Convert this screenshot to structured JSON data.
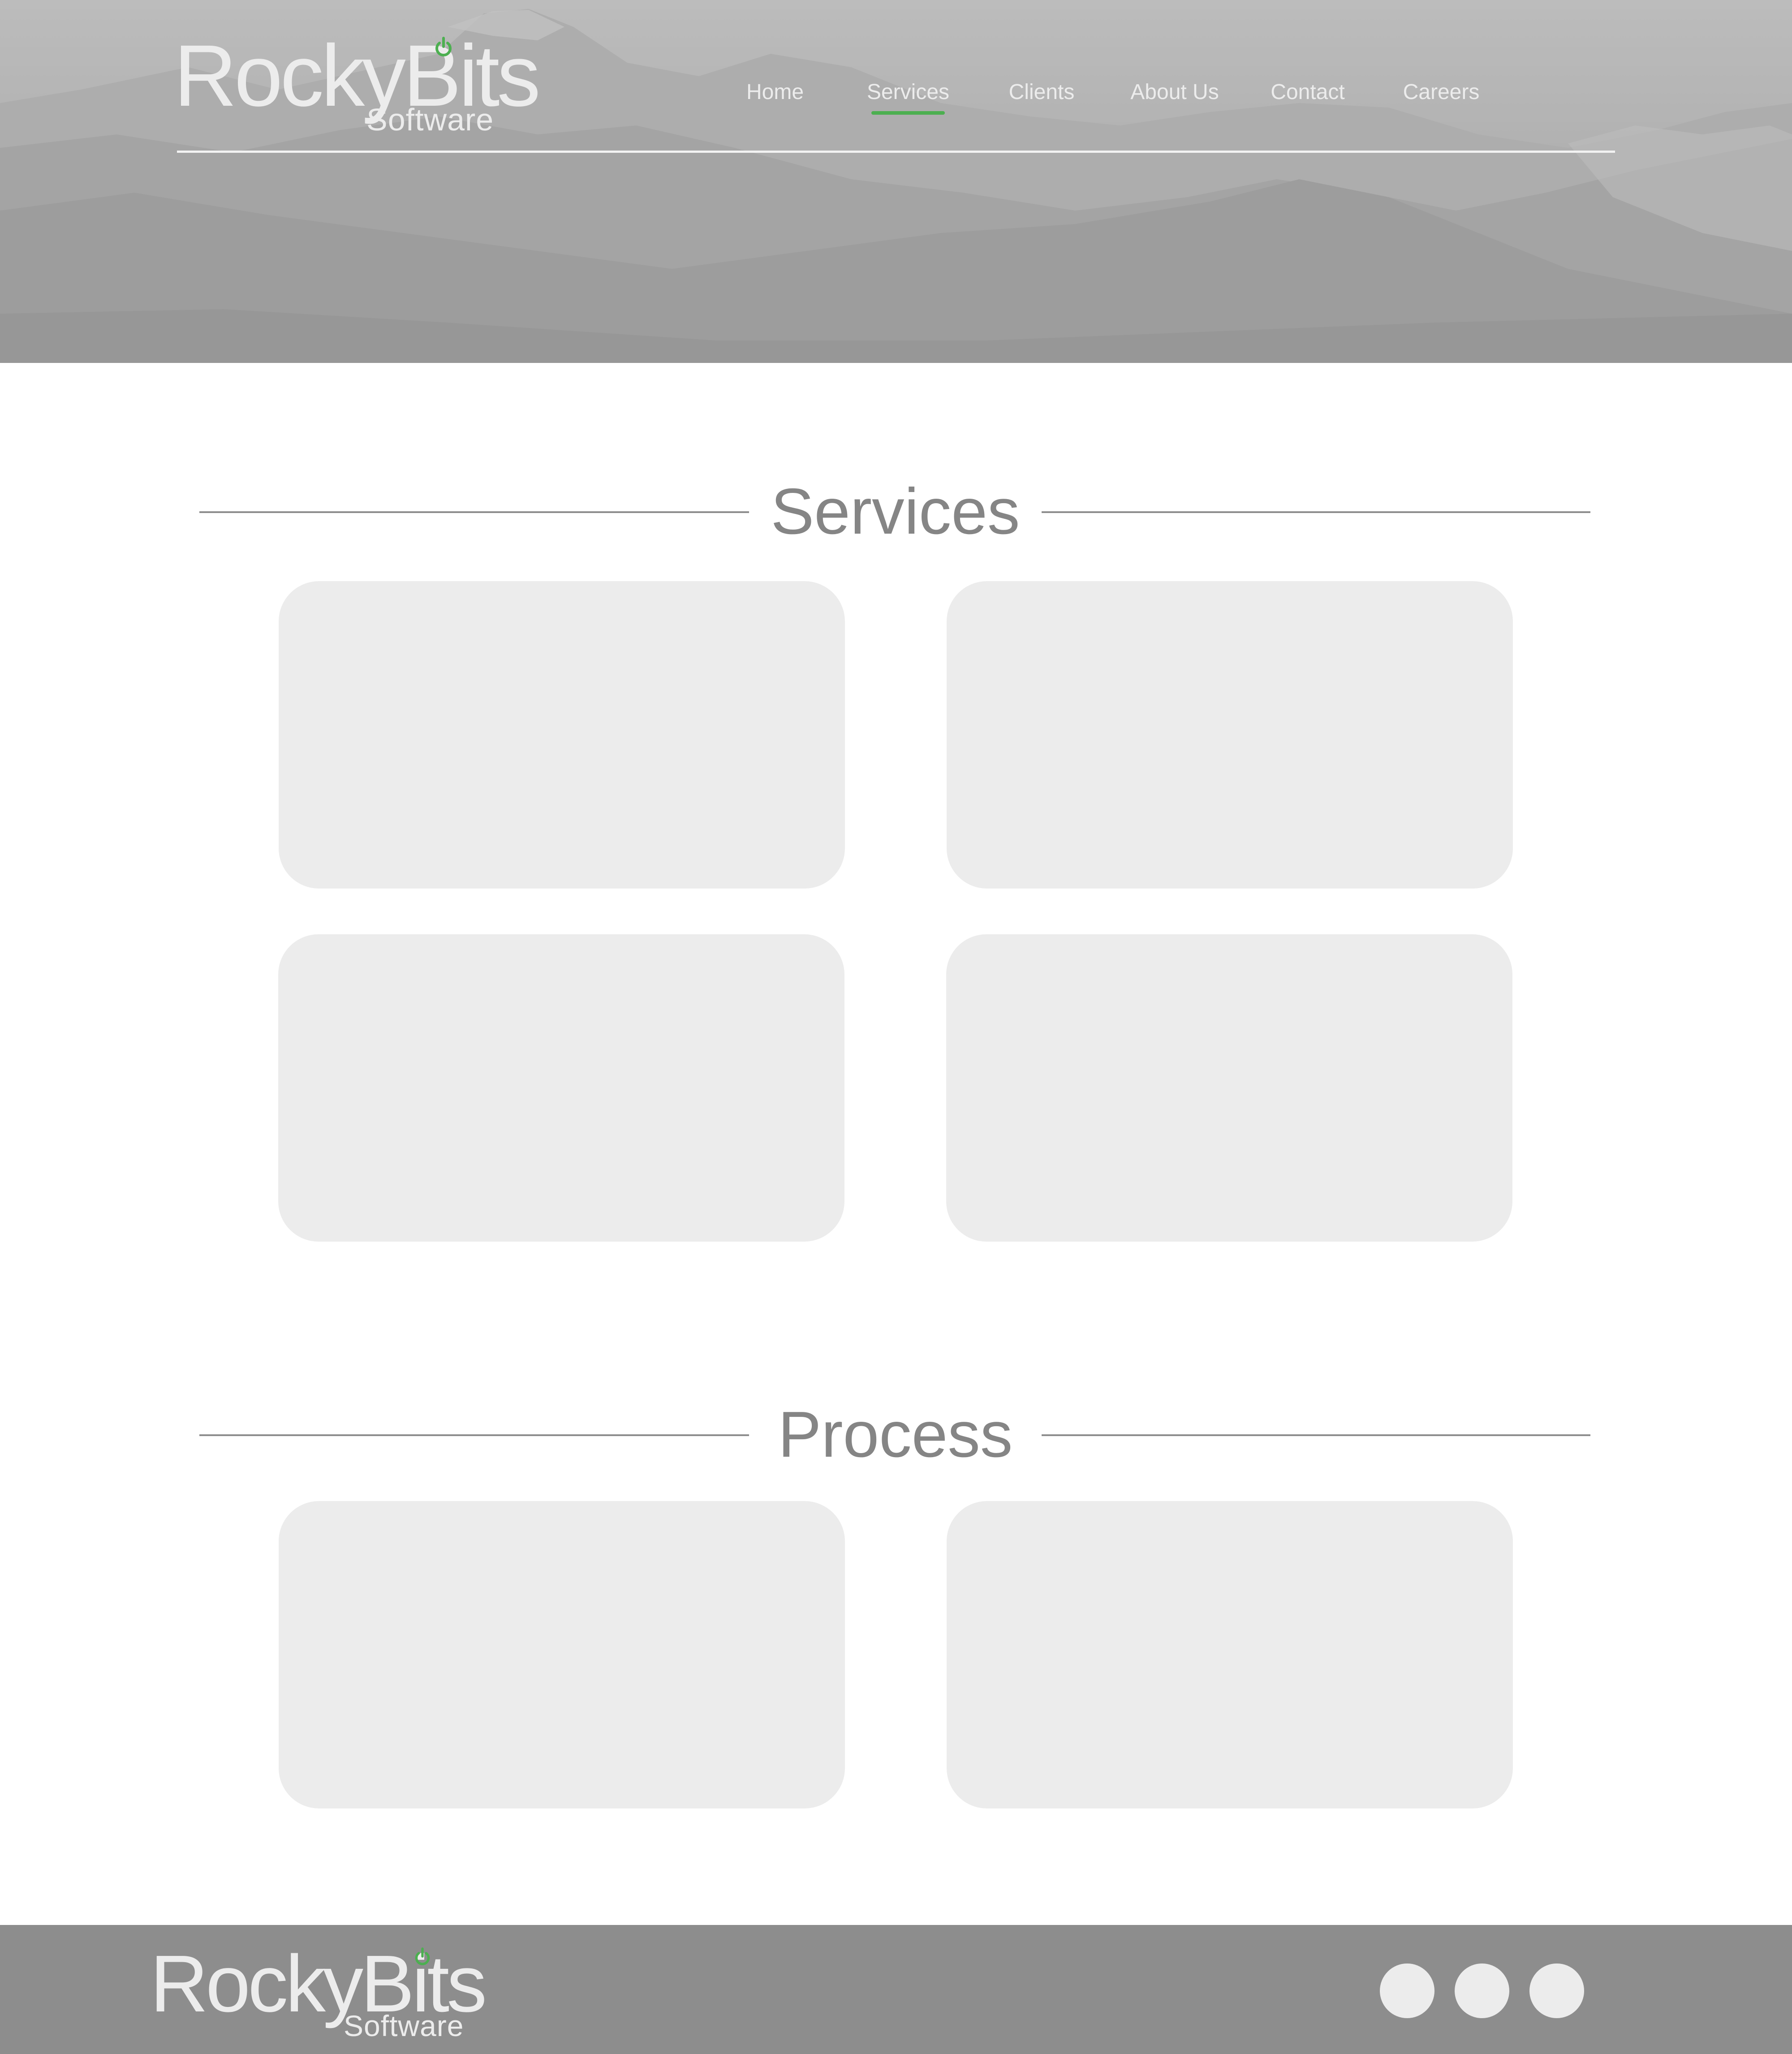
{
  "brand": {
    "name": "RockyBits",
    "tagline": "Software",
    "accent_color": "#4caf50"
  },
  "nav": {
    "items": [
      {
        "label": "Home",
        "active": false
      },
      {
        "label": "Services",
        "active": true
      },
      {
        "label": "Clients",
        "active": false
      },
      {
        "label": "About Us",
        "active": false
      },
      {
        "label": "Contact",
        "active": false
      },
      {
        "label": "Careers",
        "active": false
      }
    ]
  },
  "sections": {
    "services": {
      "title": "Services",
      "card_count": 4
    },
    "process": {
      "title": "Process",
      "card_count": 2
    }
  },
  "footer": {
    "brand_name": "RockyBits",
    "brand_tagline": "Software",
    "social_icons": [
      "social-icon-1",
      "social-icon-2",
      "social-icon-3"
    ]
  },
  "colors": {
    "hero_overlay": "#b5b5b5",
    "footer_bg": "#8d8d8d",
    "card_bg": "#ececec",
    "heading_text": "#858585",
    "nav_text": "#ececec"
  }
}
